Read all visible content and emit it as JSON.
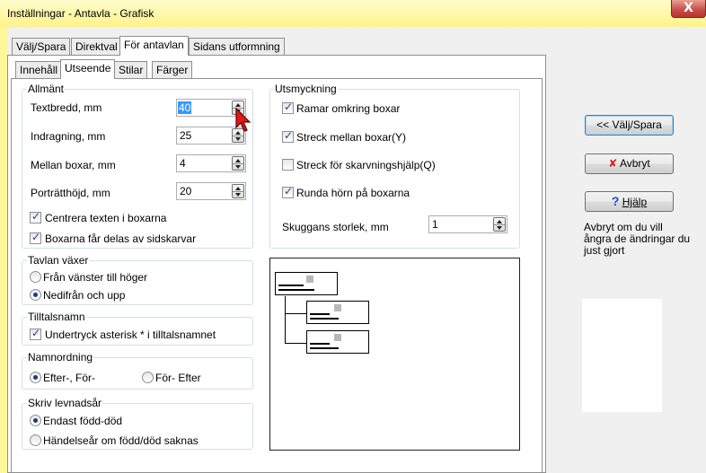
{
  "window": {
    "title": "Inställningar - Antavla - Grafisk",
    "close_label": "X"
  },
  "main_tabs": [
    "Välj/Spara",
    "Direktval",
    "För antavlan",
    "Sidans utformning"
  ],
  "sub_tabs": [
    "Innehåll",
    "Utseende",
    "Stilar",
    "Färger"
  ],
  "allmant": {
    "label": "Allmänt",
    "fields": [
      {
        "label": "Textbredd, mm",
        "value": "40"
      },
      {
        "label": "Indragning, mm",
        "value": "25"
      },
      {
        "label": "Mellan boxar, mm",
        "value": "4"
      },
      {
        "label": "Porträtthöjd, mm",
        "value": "20"
      }
    ],
    "checks": [
      {
        "label": "Centrera texten i boxarna",
        "checked": true
      },
      {
        "label": "Boxarna får delas av sidskarvar",
        "checked": true
      }
    ]
  },
  "utsmyckning": {
    "label": "Utsmyckning",
    "checks": [
      {
        "label": "Ramar omkring boxar",
        "checked": true
      },
      {
        "label": "Streck mellan boxar(Y)",
        "checked": true
      },
      {
        "label": "Streck för skarvningshjälp(Q)",
        "checked": false
      },
      {
        "label": "Runda hörn på boxarna",
        "checked": true
      }
    ],
    "shadow_label": "Skuggans storlek, mm",
    "shadow_value": "1"
  },
  "tavlan": {
    "label": "Tavlan växer",
    "options": [
      {
        "label": "Från vänster till höger",
        "selected": false
      },
      {
        "label": "Nedifrån och upp",
        "selected": true
      }
    ]
  },
  "tilltalsnamn": {
    "label": "Tilltalsnamn",
    "check": {
      "label": "Undertryck asterisk * i tilltalsnamnet",
      "checked": true
    }
  },
  "namnordning": {
    "label": "Namnordning",
    "options": [
      {
        "label": "Efter-, För-",
        "selected": true
      },
      {
        "label": "För- Efter",
        "selected": false
      }
    ]
  },
  "levnadsar": {
    "label": "Skriv levnadsår",
    "options": [
      {
        "label": "Endast född-död",
        "selected": true
      },
      {
        "label": "Händelseår om född/död saknas",
        "selected": false
      }
    ]
  },
  "buttons": {
    "valj_spara": "<< Välj/Spara",
    "avbryt": "Avbryt",
    "hjalp": "Hjälp"
  },
  "help_text": "Avbryt om du vill ångra de ändringar du just gjort",
  "icons": {
    "cancel": "red-x-icon",
    "help": "question-mark-icon",
    "cursor": "arrow-cursor-icon"
  },
  "colors": {
    "title_bar": "#fff38a",
    "close_button": "#c75050",
    "selection": "#3399ff"
  }
}
